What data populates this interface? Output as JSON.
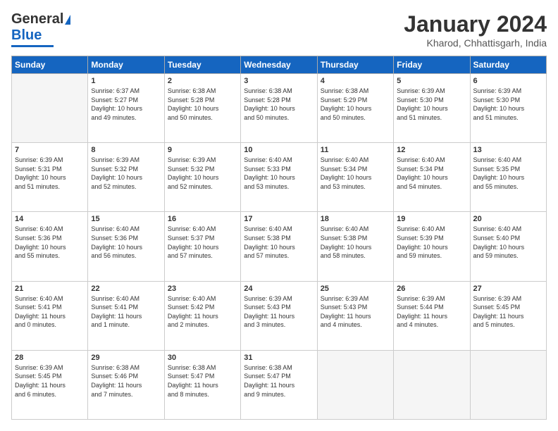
{
  "header": {
    "logo_general": "General",
    "logo_blue": "Blue",
    "month_title": "January 2024",
    "location": "Kharod, Chhattisgarh, India"
  },
  "weekdays": [
    "Sunday",
    "Monday",
    "Tuesday",
    "Wednesday",
    "Thursday",
    "Friday",
    "Saturday"
  ],
  "weeks": [
    [
      {
        "day": "",
        "info": ""
      },
      {
        "day": "1",
        "info": "Sunrise: 6:37 AM\nSunset: 5:27 PM\nDaylight: 10 hours\nand 49 minutes."
      },
      {
        "day": "2",
        "info": "Sunrise: 6:38 AM\nSunset: 5:28 PM\nDaylight: 10 hours\nand 50 minutes."
      },
      {
        "day": "3",
        "info": "Sunrise: 6:38 AM\nSunset: 5:28 PM\nDaylight: 10 hours\nand 50 minutes."
      },
      {
        "day": "4",
        "info": "Sunrise: 6:38 AM\nSunset: 5:29 PM\nDaylight: 10 hours\nand 50 minutes."
      },
      {
        "day": "5",
        "info": "Sunrise: 6:39 AM\nSunset: 5:30 PM\nDaylight: 10 hours\nand 51 minutes."
      },
      {
        "day": "6",
        "info": "Sunrise: 6:39 AM\nSunset: 5:30 PM\nDaylight: 10 hours\nand 51 minutes."
      }
    ],
    [
      {
        "day": "7",
        "info": "Sunrise: 6:39 AM\nSunset: 5:31 PM\nDaylight: 10 hours\nand 51 minutes."
      },
      {
        "day": "8",
        "info": "Sunrise: 6:39 AM\nSunset: 5:32 PM\nDaylight: 10 hours\nand 52 minutes."
      },
      {
        "day": "9",
        "info": "Sunrise: 6:39 AM\nSunset: 5:32 PM\nDaylight: 10 hours\nand 52 minutes."
      },
      {
        "day": "10",
        "info": "Sunrise: 6:40 AM\nSunset: 5:33 PM\nDaylight: 10 hours\nand 53 minutes."
      },
      {
        "day": "11",
        "info": "Sunrise: 6:40 AM\nSunset: 5:34 PM\nDaylight: 10 hours\nand 53 minutes."
      },
      {
        "day": "12",
        "info": "Sunrise: 6:40 AM\nSunset: 5:34 PM\nDaylight: 10 hours\nand 54 minutes."
      },
      {
        "day": "13",
        "info": "Sunrise: 6:40 AM\nSunset: 5:35 PM\nDaylight: 10 hours\nand 55 minutes."
      }
    ],
    [
      {
        "day": "14",
        "info": "Sunrise: 6:40 AM\nSunset: 5:36 PM\nDaylight: 10 hours\nand 55 minutes."
      },
      {
        "day": "15",
        "info": "Sunrise: 6:40 AM\nSunset: 5:36 PM\nDaylight: 10 hours\nand 56 minutes."
      },
      {
        "day": "16",
        "info": "Sunrise: 6:40 AM\nSunset: 5:37 PM\nDaylight: 10 hours\nand 57 minutes."
      },
      {
        "day": "17",
        "info": "Sunrise: 6:40 AM\nSunset: 5:38 PM\nDaylight: 10 hours\nand 57 minutes."
      },
      {
        "day": "18",
        "info": "Sunrise: 6:40 AM\nSunset: 5:38 PM\nDaylight: 10 hours\nand 58 minutes."
      },
      {
        "day": "19",
        "info": "Sunrise: 6:40 AM\nSunset: 5:39 PM\nDaylight: 10 hours\nand 59 minutes."
      },
      {
        "day": "20",
        "info": "Sunrise: 6:40 AM\nSunset: 5:40 PM\nDaylight: 10 hours\nand 59 minutes."
      }
    ],
    [
      {
        "day": "21",
        "info": "Sunrise: 6:40 AM\nSunset: 5:41 PM\nDaylight: 11 hours\nand 0 minutes."
      },
      {
        "day": "22",
        "info": "Sunrise: 6:40 AM\nSunset: 5:41 PM\nDaylight: 11 hours\nand 1 minute."
      },
      {
        "day": "23",
        "info": "Sunrise: 6:40 AM\nSunset: 5:42 PM\nDaylight: 11 hours\nand 2 minutes."
      },
      {
        "day": "24",
        "info": "Sunrise: 6:39 AM\nSunset: 5:43 PM\nDaylight: 11 hours\nand 3 minutes."
      },
      {
        "day": "25",
        "info": "Sunrise: 6:39 AM\nSunset: 5:43 PM\nDaylight: 11 hours\nand 4 minutes."
      },
      {
        "day": "26",
        "info": "Sunrise: 6:39 AM\nSunset: 5:44 PM\nDaylight: 11 hours\nand 4 minutes."
      },
      {
        "day": "27",
        "info": "Sunrise: 6:39 AM\nSunset: 5:45 PM\nDaylight: 11 hours\nand 5 minutes."
      }
    ],
    [
      {
        "day": "28",
        "info": "Sunrise: 6:39 AM\nSunset: 5:45 PM\nDaylight: 11 hours\nand 6 minutes."
      },
      {
        "day": "29",
        "info": "Sunrise: 6:38 AM\nSunset: 5:46 PM\nDaylight: 11 hours\nand 7 minutes."
      },
      {
        "day": "30",
        "info": "Sunrise: 6:38 AM\nSunset: 5:47 PM\nDaylight: 11 hours\nand 8 minutes."
      },
      {
        "day": "31",
        "info": "Sunrise: 6:38 AM\nSunset: 5:47 PM\nDaylight: 11 hours\nand 9 minutes."
      },
      {
        "day": "",
        "info": ""
      },
      {
        "day": "",
        "info": ""
      },
      {
        "day": "",
        "info": ""
      }
    ]
  ]
}
